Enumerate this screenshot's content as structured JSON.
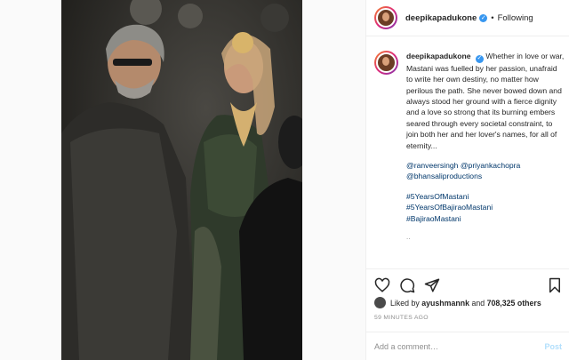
{
  "post": {
    "image_alt": "Director and actress in bridal costume on set",
    "username": "deepikapadukone",
    "verified": true,
    "separator": "•",
    "follow_status": "Following",
    "caption": "Whether in love or war, Mastani was fuelled by her passion, unafraid to write her own destiny, no matter how perilous the path. She never bowed down and always stood her ground with a fierce dignity and a love so strong that its burning embers seared through every societal constraint, to join both her and her lover's names, for all of eternity...",
    "mentions": [
      "@ranveersingh",
      "@priyankachopra",
      "@bhansaliproductions"
    ],
    "hashtags": [
      "#5YearsOfMastani",
      "#5YearsOfBajiraoMastani",
      "#BajiraoMastani"
    ],
    "more": "..",
    "likes_prefix": "Liked by",
    "liked_by_user": "ayushmannk",
    "likes_conjunction": "and",
    "likes_count": "708,325 others",
    "timestamp": "59 MINUTES AGO",
    "comment_placeholder": "Add a comment…",
    "post_button": "Post"
  },
  "icons": {
    "like": "heart-icon",
    "comment": "comment-icon",
    "share": "share-icon",
    "save": "bookmark-icon",
    "verified": "verified-check-icon"
  },
  "colors": {
    "link": "#00376b",
    "verified": "#3897f0",
    "post_disabled": "#b2dffc",
    "muted": "#8e8e8e"
  }
}
